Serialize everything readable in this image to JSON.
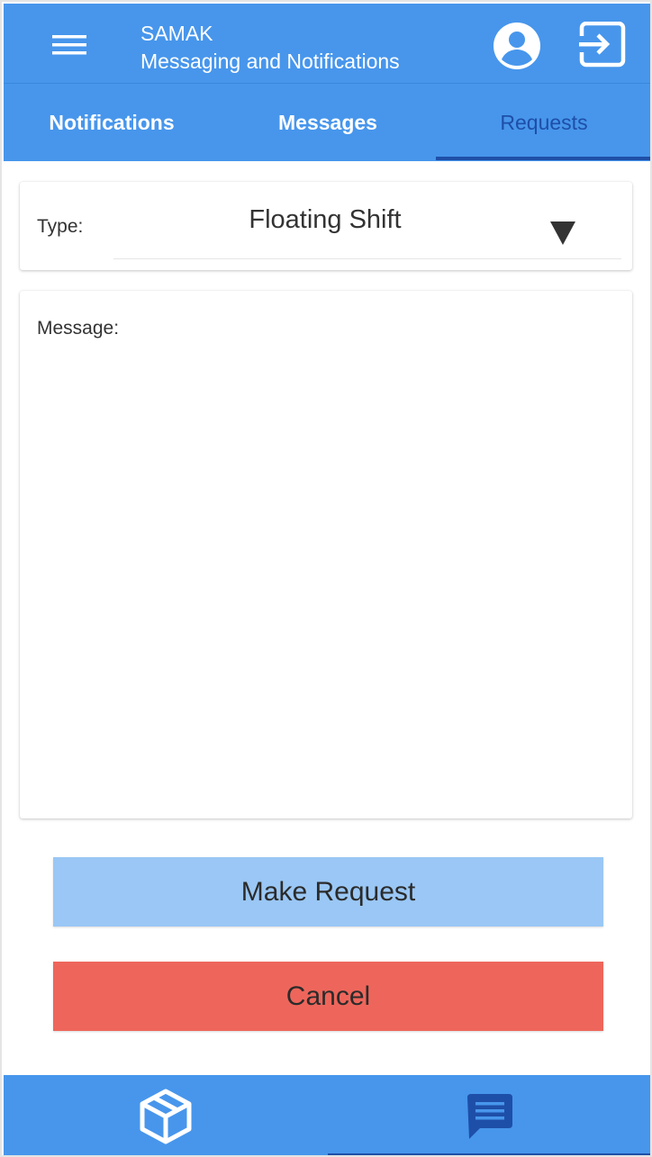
{
  "header": {
    "app_name": "SAMAK",
    "subtitle": "Messaging and Notifications",
    "menu_icon": "hamburger-menu-icon",
    "profile_icon": "account-circle-icon",
    "logout_icon": "exit-icon"
  },
  "tabs": [
    {
      "label": "Notifications",
      "active": false
    },
    {
      "label": "Messages",
      "active": false
    },
    {
      "label": "Requests",
      "active": true
    }
  ],
  "form": {
    "type_label": "Type:",
    "type_value": "Floating Shift",
    "message_label": "Message:",
    "message_value": ""
  },
  "buttons": {
    "make_request": "Make Request",
    "cancel": "Cancel"
  },
  "bottom_nav": [
    {
      "icon": "box-icon",
      "active": false
    },
    {
      "icon": "chat-message-icon",
      "active": true
    }
  ],
  "colors": {
    "primary": "#4796ec",
    "active_accent": "#1e4fa8",
    "request_button": "#9ac7f5",
    "cancel_button": "#ee665b"
  }
}
